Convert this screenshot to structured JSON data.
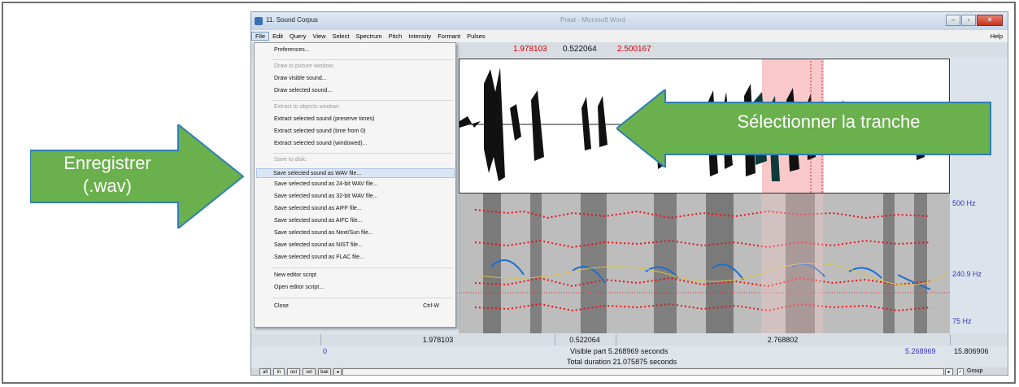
{
  "window": {
    "title": "11. Sound Corpus",
    "center_title": "Praat - Microsoft Word"
  },
  "menubar": {
    "items": [
      "File",
      "Edit",
      "Query",
      "View",
      "Select",
      "Spectrum",
      "Pitch",
      "Intensity",
      "Formant",
      "Pulses"
    ],
    "help": "Help"
  },
  "time_row": {
    "left": "1.978103",
    "selection": "0.522064",
    "right": "2.500167"
  },
  "file_menu": {
    "items": [
      {
        "label": "Preferences...",
        "kind": "item"
      },
      {
        "label": "Draw to picture window:",
        "kind": "section"
      },
      {
        "label": "Draw visible sound...",
        "kind": "item"
      },
      {
        "label": "Draw selected sound...",
        "kind": "item"
      },
      {
        "label": "Extract to objects window:",
        "kind": "section"
      },
      {
        "label": "Extract selected sound (preserve times)",
        "kind": "item"
      },
      {
        "label": "Extract selected sound (time from 0)",
        "kind": "item"
      },
      {
        "label": "Extract selected sound (windowed)...",
        "kind": "item"
      },
      {
        "label": "Save to disk:",
        "kind": "section"
      },
      {
        "label": "Save selected sound as WAV file...",
        "kind": "highlight"
      },
      {
        "label": "Save selected sound as 24-bit WAV file...",
        "kind": "item"
      },
      {
        "label": "Save selected sound as 32-bit WAV file...",
        "kind": "item"
      },
      {
        "label": "Save selected sound as AIFF file...",
        "kind": "item"
      },
      {
        "label": "Save selected sound as AIFC file...",
        "kind": "item"
      },
      {
        "label": "Save selected sound as Next/Sun file...",
        "kind": "item"
      },
      {
        "label": "Save selected sound as NIST file...",
        "kind": "item"
      },
      {
        "label": "Save selected sound as FLAC file...",
        "kind": "item"
      },
      {
        "label": "New editor script",
        "kind": "item"
      },
      {
        "label": "Open editor script...",
        "kind": "item"
      },
      {
        "label": "Close",
        "kind": "item"
      }
    ],
    "close_shortcut": "Ctrl-W"
  },
  "freq_labels": {
    "top": "500 Hz",
    "mid": "240.9 Hz",
    "bottom": "75 Hz"
  },
  "bottom_row1": {
    "left": "1.978103",
    "selection": "0.522064",
    "right": "2.768802"
  },
  "bottom_row2": {
    "start": "0",
    "visible": "Visible part 5.268969 seconds",
    "visible_end": "5.268969",
    "total_end": "15.806906"
  },
  "bottom_row3": {
    "total": "Total duration 21.075875 seconds"
  },
  "controls": {
    "buttons": [
      "all",
      "in",
      "out",
      "sel",
      "bak"
    ],
    "group": "Group"
  },
  "annotations": {
    "left_arrow": {
      "line1": "Enregistrer",
      "line2": "(.wav)"
    },
    "right_arrow": "Sélectionner la tranche",
    "arrow_color": "#6ab04c",
    "arrow_border": "#2f7fb5"
  },
  "colors": {
    "selection": "#f9c8c8",
    "time_red": "#d40000",
    "freq_blue": "#3333cc",
    "freq_green": "#33cc33"
  }
}
